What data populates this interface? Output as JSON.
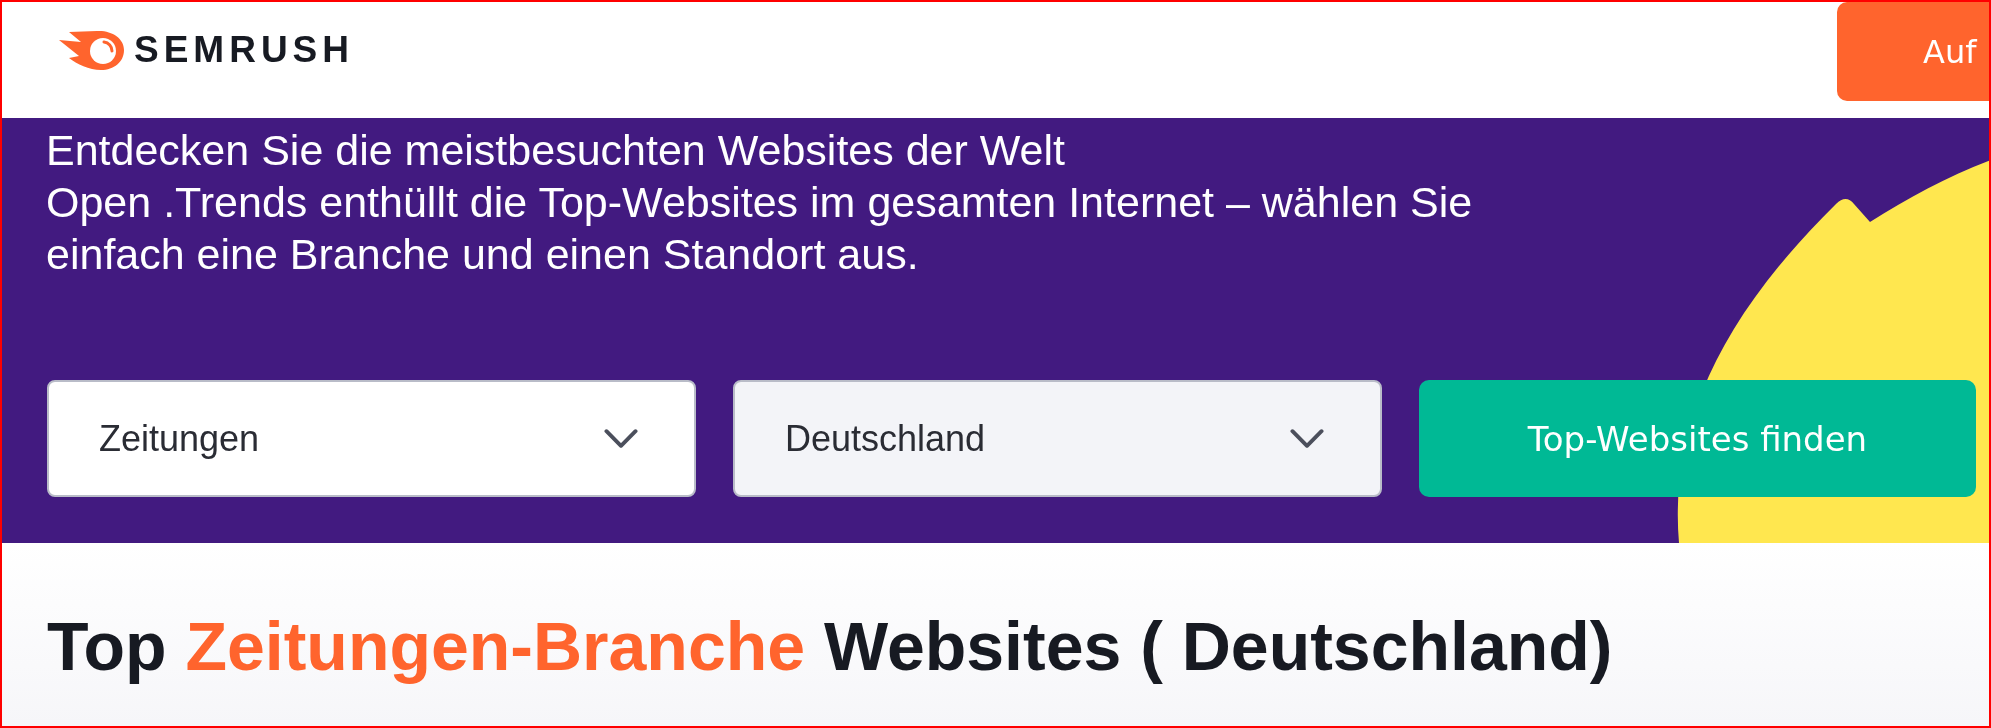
{
  "header": {
    "logo": {
      "text": "SEMRUSH"
    },
    "cta_button": {
      "label": "Auf"
    }
  },
  "hero": {
    "title": "Entdecken Sie die meistbesuchten Websites der Welt",
    "subtitle": "Open .Trends enthüllt die Top-Websites im gesamten Internet – wählen Sie einfach eine Branche und einen Standort aus.",
    "filters": [
      {
        "value": "Zeitungen",
        "hovered": false
      },
      {
        "value": "Deutschland",
        "hovered": true
      }
    ],
    "submit_button": {
      "label": "Top-Websites finden"
    }
  },
  "results": {
    "heading": [
      {
        "text": "Top ",
        "highlight": false
      },
      {
        "text": "Zeitungen-Branche",
        "highlight": true
      },
      {
        "text": " Websites ( Deutschland)",
        "highlight": false
      }
    ]
  }
}
